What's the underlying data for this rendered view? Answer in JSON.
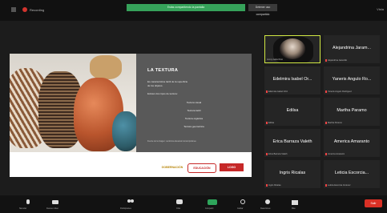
{
  "topbar": {
    "recording_label": "Recording",
    "share_banner": "Estás compartiendo la pantalla",
    "stop_share_label": "Detener uso compartido",
    "view_label": "Vista"
  },
  "slide": {
    "title": "LA TEXTURA",
    "intro_line1": "Es característica táctil de la superficie",
    "intro_line2": "de los objetos.",
    "list_heading": "Existen dos tipos de textura:",
    "bullets": [
      "Textura visual",
      "Textura táctil",
      "Textura orgánica",
      "Textura geométrica"
    ],
    "footnote": "Fuente de la imagen: cerámica artesanal contemporánea",
    "logos": [
      "GOBERNACIÓN",
      "EDUCACIÓN",
      "LOGO"
    ]
  },
  "participants": [
    {
      "name": "Jenny Isabel Ruiz",
      "sub": "Jenny Isabel Ruiz",
      "has_video": true
    },
    {
      "name": "Alejandrina Jaram...",
      "sub": "Alejandrina Jaramillo"
    },
    {
      "name": "Edelmira Isabel Or...",
      "sub": "Edelmira Isabel Ortiz"
    },
    {
      "name": "Yaneris Angulo Ro...",
      "sub": "Yaneris Angulo Rodríguez"
    },
    {
      "name": "Edilsa",
      "sub": "Edilsa"
    },
    {
      "name": "Martha Paramo",
      "sub": "Martha Paramo"
    },
    {
      "name": "Erica Barraza Valeth",
      "sub": "Erica Barraza Valeth"
    },
    {
      "name": "America Amaranto",
      "sub": "America Amaranto"
    },
    {
      "name": "Ingris Ricalas",
      "sub": "Ingris Ricalas"
    },
    {
      "name": "Leticia Escorcia...",
      "sub": "Leticia Escorcia Jiménez"
    }
  ],
  "toolbar": {
    "mic_label": "Silenciar",
    "cam_label": "Detener video",
    "participants_label": "Participantes",
    "chat_label": "Chat",
    "share_label": "Compartir",
    "record_label": "Grabar",
    "reactions_label": "Reacciones",
    "more_label": "Más",
    "end_label": "Salir"
  },
  "colors": {
    "share_green": "#36a25a",
    "end_red": "#d93025",
    "active_border": "#d1e843"
  }
}
